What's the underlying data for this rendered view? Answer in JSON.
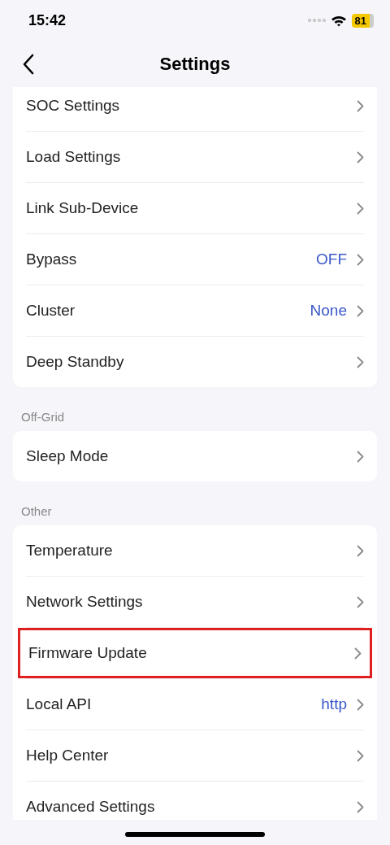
{
  "status_bar": {
    "time": "15:42",
    "battery": "81"
  },
  "nav": {
    "title": "Settings"
  },
  "sections": [
    {
      "items": [
        {
          "label": "SOC Settings"
        },
        {
          "label": "Load Settings"
        },
        {
          "label": "Link Sub-Device"
        },
        {
          "label": "Bypass",
          "value": "OFF"
        },
        {
          "label": "Cluster",
          "value": "None"
        },
        {
          "label": "Deep Standby"
        }
      ]
    },
    {
      "title": "Off-Grid",
      "items": [
        {
          "label": "Sleep Mode"
        }
      ]
    },
    {
      "title": "Other",
      "items": [
        {
          "label": "Temperature"
        },
        {
          "label": "Network Settings"
        },
        {
          "label": "Firmware Update",
          "highlighted": true
        },
        {
          "label": "Local API",
          "value": "http"
        },
        {
          "label": "Help Center"
        },
        {
          "label": "Advanced Settings"
        }
      ]
    }
  ]
}
